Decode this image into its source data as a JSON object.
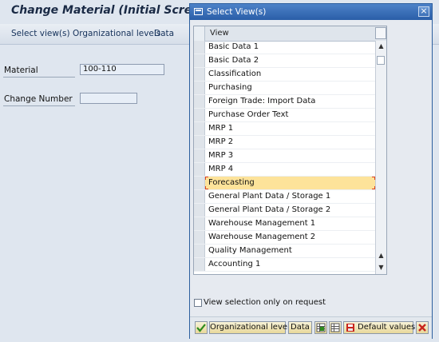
{
  "main": {
    "title": "Change Material (Initial Screen)",
    "toolbar": [
      "Select view(s)",
      "Organizational levels",
      "Data"
    ],
    "material": {
      "label": "Material",
      "value": "100-110"
    },
    "change_number": {
      "label": "Change Number",
      "value": ""
    }
  },
  "dialog": {
    "title": "Select View(s)",
    "column_header": "View",
    "rows": [
      "Basic Data 1",
      "Basic Data 2",
      "Classification",
      "Purchasing",
      "Foreign Trade: Import Data",
      "Purchase Order Text",
      "MRP 1",
      "MRP 2",
      "MRP 3",
      "MRP 4",
      "Forecasting",
      "General Plant Data / Storage 1",
      "General Plant Data / Storage 2",
      "Warehouse Management 1",
      "Warehouse Management 2",
      "Quality Management",
      "Accounting 1"
    ],
    "highlighted_row": "Forecasting",
    "checkbox_label": "View selection only on request",
    "buttons": {
      "org_levels": "Organizational levels",
      "data": "Data",
      "default_values": "Default values"
    },
    "close_glyph": "×"
  },
  "colors": {
    "highlight": "#fde39a",
    "title_bar": "#2a5ea8",
    "confirm_green": "#2e8b1f",
    "cancel_red": "#c8251d"
  }
}
